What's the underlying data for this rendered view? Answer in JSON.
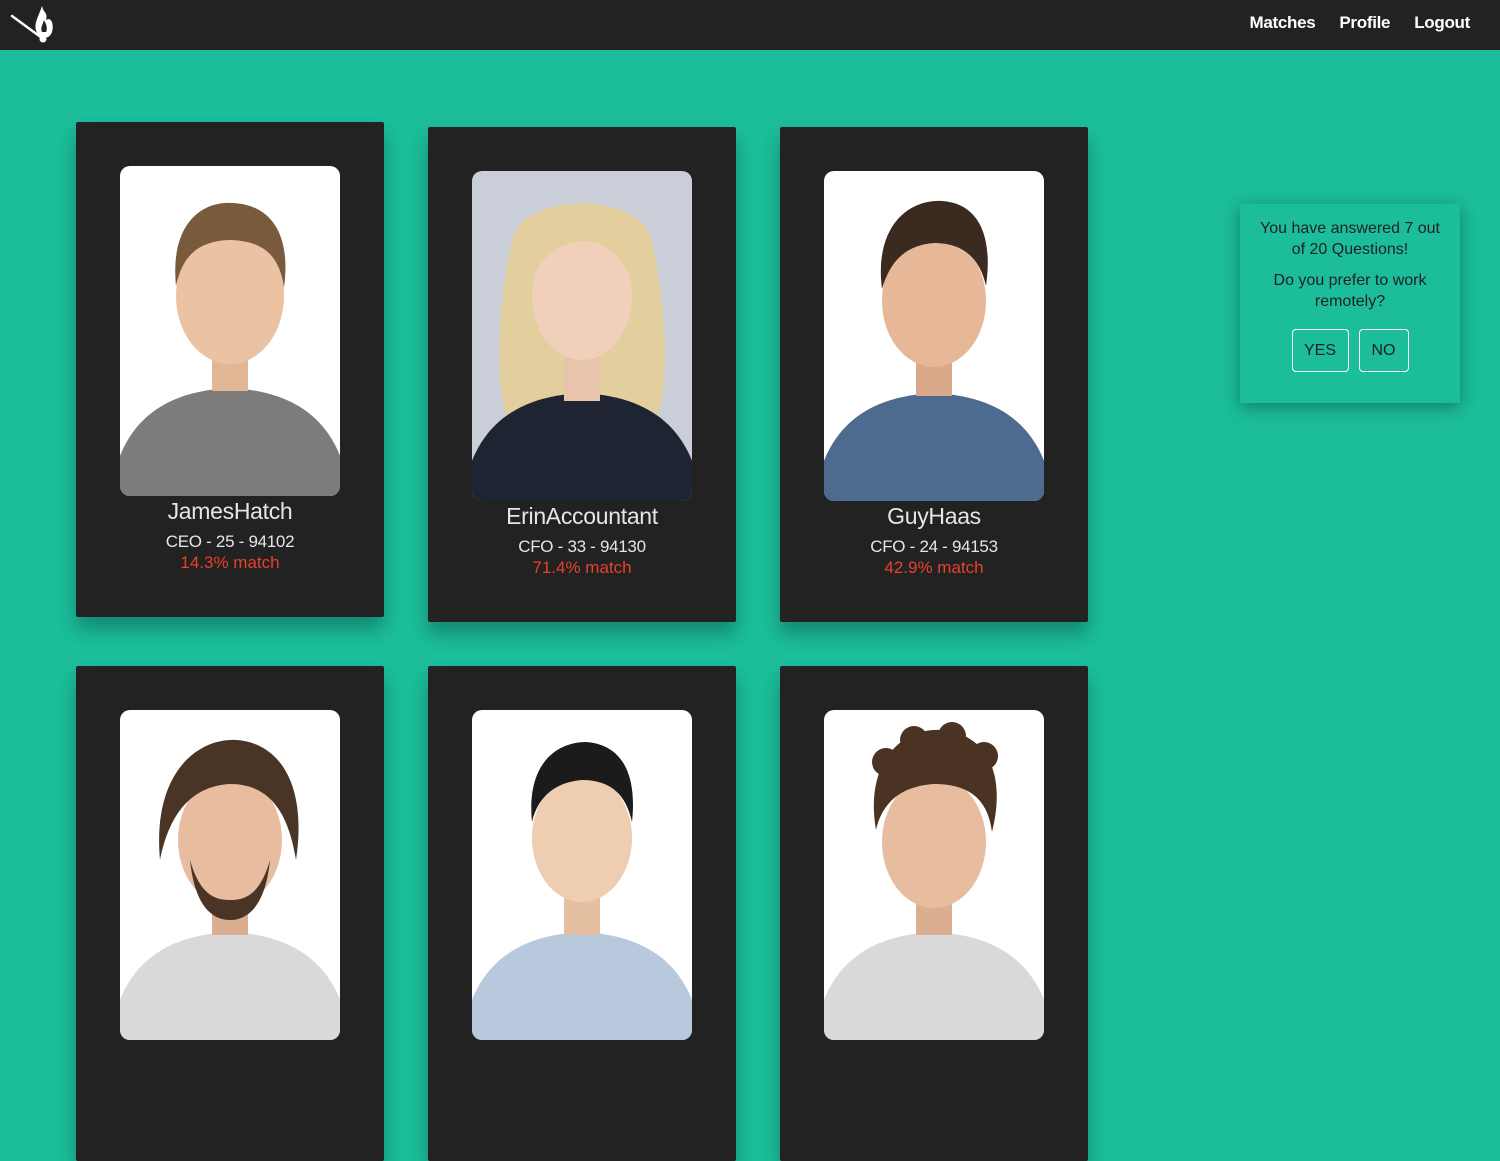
{
  "nav": {
    "matches_label": "Matches",
    "profile_label": "Profile",
    "logout_label": "Logout"
  },
  "cards": [
    {
      "name": "JamesHatch",
      "details": "CEO - 25 - 94102",
      "match": "14.3% match",
      "photo_bg": "#ffffff",
      "hair": "#7a5a3c",
      "shirt": "#7c7c7c"
    },
    {
      "name": "ErinAccountant",
      "details": "CFO - 33 - 94130",
      "match": "71.4% match",
      "photo_bg": "#c9ced8",
      "hair": "#e3cf9d",
      "shirt": "#1f2433"
    },
    {
      "name": "GuyHaas",
      "details": "CFO - 24 - 94153",
      "match": "42.9% match",
      "photo_bg": "#ffffff",
      "hair": "#3a2a20",
      "shirt": "#4d6a8f"
    },
    {
      "photo_bg": "#ffffff",
      "hair": "#4a3426",
      "shirt": "#d9d9d9"
    },
    {
      "photo_bg": "#ffffff",
      "hair": "#1b1b1b",
      "shirt": "#b9c9dd"
    },
    {
      "photo_bg": "#ffffff",
      "hair": "#4b3324",
      "shirt": "#d9d9d9"
    }
  ],
  "question": {
    "progress": "You have answered 7 out of 20 Questions!",
    "text": "Do you prefer to work remotely?",
    "yes_label": "YES",
    "no_label": "NO"
  },
  "colors": {
    "background": "#1bbd9b",
    "navbar": "#222222",
    "card": "#222222",
    "match_text": "#e8402c"
  }
}
